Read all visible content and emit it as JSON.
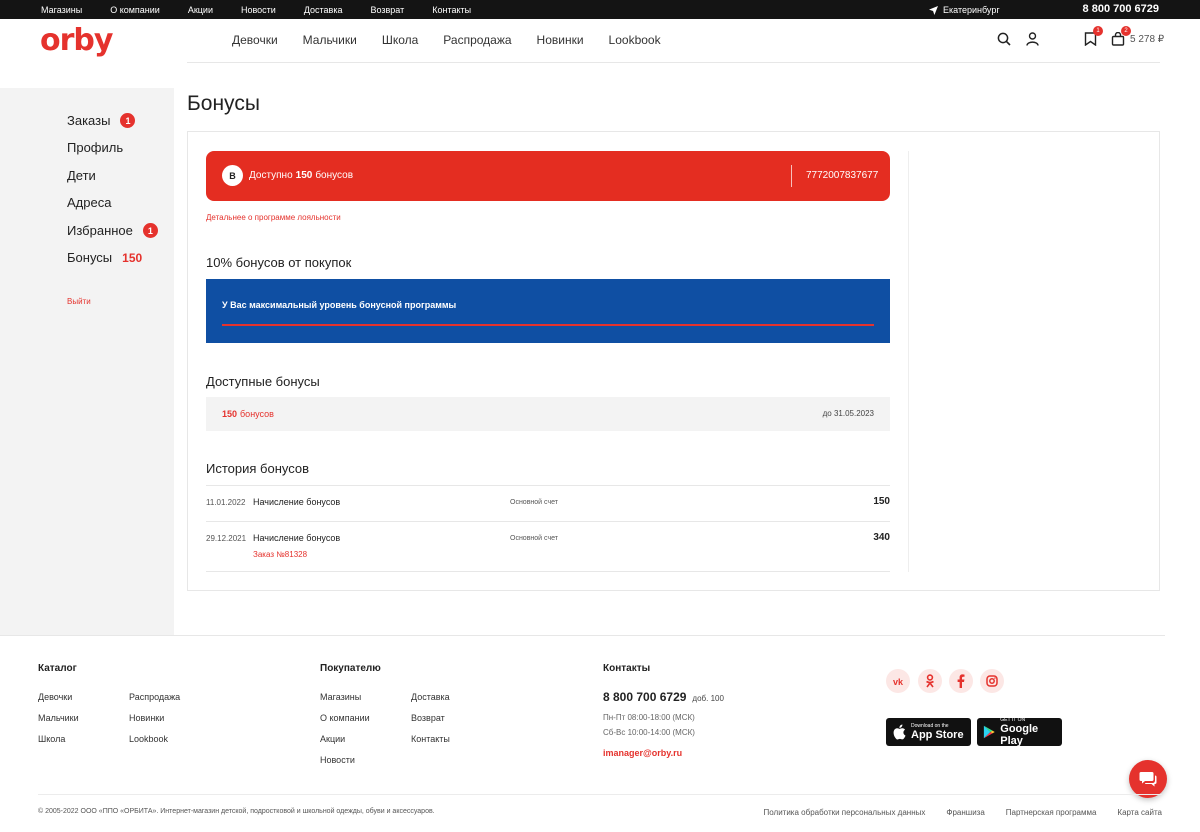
{
  "topbar": {
    "links": [
      "Магазины",
      "О компании",
      "Акции",
      "Новости",
      "Доставка",
      "Возврат",
      "Контакты"
    ],
    "city": "Екатеринбург",
    "phone": "8 800 700 6729"
  },
  "header": {
    "logo": "orby",
    "nav": [
      "Девочки",
      "Мальчики",
      "Школа",
      "Распродажа",
      "Новинки",
      "Lookbook"
    ],
    "wishlist_badge": "1",
    "cart_badge": "2",
    "cart_sum": "5 278 ₽"
  },
  "sidebar": {
    "items": [
      {
        "label": "Заказы",
        "badge": "1"
      },
      {
        "label": "Профиль"
      },
      {
        "label": "Дети"
      },
      {
        "label": "Адреса"
      },
      {
        "label": "Избранное",
        "badge": "1"
      },
      {
        "label": "Бонусы",
        "count": "150"
      }
    ],
    "logout": "Выйти"
  },
  "main": {
    "title": "Бонусы",
    "card": {
      "initial": "В",
      "available_prefix": "Доступно",
      "available_amount": "150",
      "available_suffix": "бонусов",
      "card_number": "7772007837677"
    },
    "loyalty_link": "Детальнее о программе лояльности",
    "level_title": "10% бонусов от покупок",
    "level_text": "У Вас максимальный уровень бонусной программы",
    "level_progress": 1.0,
    "available_title": "Доступные бонусы",
    "available": {
      "amount": "150",
      "unit": "бонусов",
      "expiry": "до 31.05.2023"
    },
    "history_title": "История бонусов",
    "history": [
      {
        "date": "11.01.2022",
        "desc": "Начисление бонусов",
        "account": "Основной счет",
        "amount": "150",
        "order": ""
      },
      {
        "date": "29.12.2021",
        "desc": "Начисление бонусов",
        "account": "Основной счет",
        "amount": "340",
        "order": "Заказ №81328"
      }
    ]
  },
  "footer": {
    "catalog": {
      "title": "Каталог",
      "col1": [
        "Девочки",
        "Мальчики",
        "Школа"
      ],
      "col2": [
        "Распродажа",
        "Новинки",
        "Lookbook"
      ]
    },
    "buyer": {
      "title": "Покупателю",
      "col1": [
        "Магазины",
        "О компании",
        "Акции",
        "Новости"
      ],
      "col2": [
        "Доставка",
        "Возврат",
        "Контакты"
      ]
    },
    "contacts": {
      "title": "Контакты",
      "phone": "8 800 700 6729",
      "ext": "доб. 100",
      "hours1": "Пн-Пт 08:00-18:00 (МСК)",
      "hours2": "Сб-Вс 10:00-14:00 (МСК)",
      "email": "imanager@orby.ru"
    },
    "social": [
      "vk-icon",
      "odnoklassniki-icon",
      "facebook-icon",
      "instagram-icon"
    ],
    "appstore": {
      "small": "Download on the",
      "big": "App Store"
    },
    "googleplay": {
      "small": "GET IT ON",
      "big": "Google Play"
    },
    "copyright": "© 2005-2022 ООО «ППО «ОРБИТА». Интернет-магазин детской, подростковой и школьной одежды, обуви и аксессуаров.",
    "bottom_links": [
      "Политика обработки персональных данных",
      "Франшиза",
      "Партнерская программа",
      "Карта сайта"
    ]
  },
  "colors": {
    "accent": "#e5322d",
    "level_box": "#0f4fa3",
    "topbar": "#141414"
  }
}
